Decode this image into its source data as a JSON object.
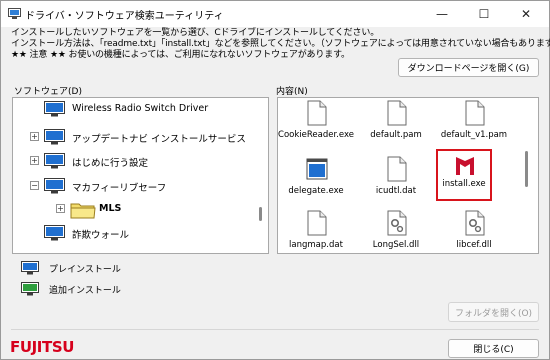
{
  "window": {
    "title": "ドライバ・ソフトウェア検索ユーティリティ",
    "controls": {
      "minimize": "—",
      "maximize": "☐",
      "close": "✕"
    }
  },
  "description": {
    "line1": "インストールしたいソフトウェアを一覧から選び、Cドライブにインストールしてください。",
    "line2": "インストール方法は、「readme.txt」「install.txt」などを参照してください。（ソフトウェアによっては用意されていない場合もあります）",
    "line3": "★★ 注意 ★★ お使いの機種によっては、ご利用になれないソフトウェアがあります。"
  },
  "buttons": {
    "download_page": "ダウンロードページを開く(G)",
    "open_folder": "フォルダを開く(O)",
    "close": "閉じる(C)"
  },
  "panels": {
    "software_label": "ソフトウェア(D)",
    "contents_label": "内容(N)"
  },
  "tree": {
    "items": [
      {
        "label": "Wireless Radio Switch Driver",
        "expander": ""
      },
      {
        "label": "アップデートナビ インストールサービス",
        "expander": "+"
      },
      {
        "label": "はじめに行う設定",
        "expander": "+"
      },
      {
        "label": "マカフィーリブセーフ",
        "expander": "−"
      },
      {
        "label": "MLS",
        "expander": "+"
      },
      {
        "label": "詐欺ウォール",
        "expander": ""
      }
    ]
  },
  "files": {
    "items": [
      {
        "label": "CookieReader.exe",
        "icon": "document-icon"
      },
      {
        "label": "default.pam",
        "icon": "document-icon"
      },
      {
        "label": "default_v1.pam",
        "icon": "document-icon"
      },
      {
        "label": "delegate.exe",
        "icon": "app-window-icon"
      },
      {
        "label": "icudtl.dat",
        "icon": "document-icon"
      },
      {
        "label": "install.exe",
        "icon": "mcafee-icon"
      },
      {
        "label": "langmap.dat",
        "icon": "document-icon"
      },
      {
        "label": "LongSel.dll",
        "icon": "settings-document-icon"
      },
      {
        "label": "libcef.dll",
        "icon": "settings-document-icon"
      }
    ]
  },
  "legend": {
    "preinstall": "プレインストール",
    "additional": "追加インストール"
  },
  "brand": {
    "logo_text": "FUJITSU",
    "logo_color": "#d6001c",
    "selection_color": "#d8141c",
    "preinstall_color": "#1f6fd0",
    "additional_color": "#2e9e3e"
  }
}
